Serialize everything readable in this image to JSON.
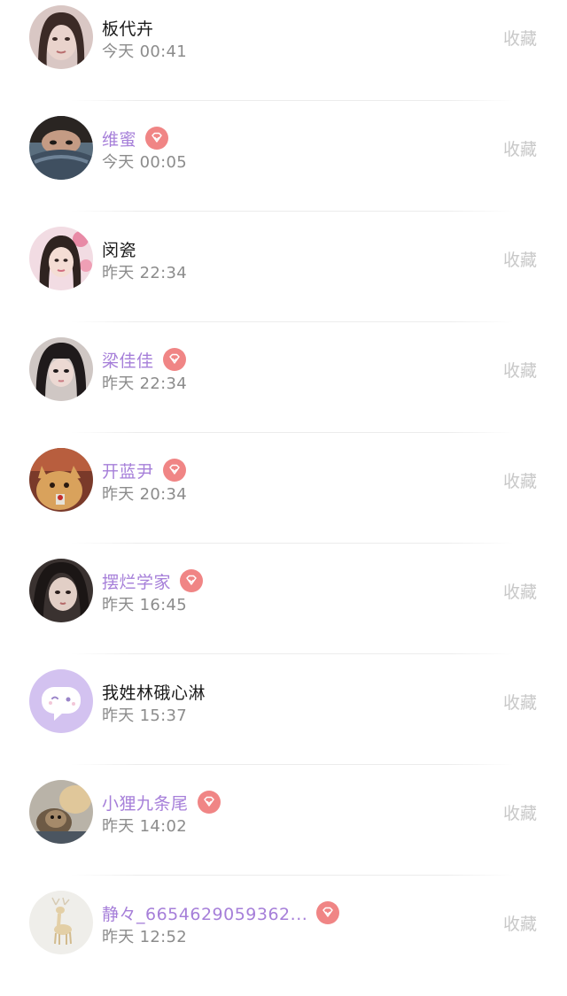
{
  "favorite_label": "收藏",
  "colors": {
    "vip_name": "#a67fd9",
    "badge": "#f08585",
    "time": "#8c8c8c",
    "favorite": "#c8c8c8"
  },
  "items": [
    {
      "name": "板代卉",
      "time": "今天 00:41",
      "vip": false
    },
    {
      "name": "维蜜",
      "time": "今天 00:05",
      "vip": true
    },
    {
      "name": "闵瓷",
      "time": "昨天 22:34",
      "vip": false
    },
    {
      "name": "梁佳佳",
      "time": "昨天 22:34",
      "vip": true
    },
    {
      "name": "开蓝尹",
      "time": "昨天 20:34",
      "vip": true
    },
    {
      "name": "摆烂学家",
      "time": "昨天 16:45",
      "vip": true
    },
    {
      "name": "我姓林硪心淋",
      "time": "昨天 15:37",
      "vip": false
    },
    {
      "name": "小狸九条尾",
      "time": "昨天 14:02",
      "vip": true
    },
    {
      "name": "静々_6654629059362...",
      "time": "昨天 12:52",
      "vip": true
    }
  ]
}
